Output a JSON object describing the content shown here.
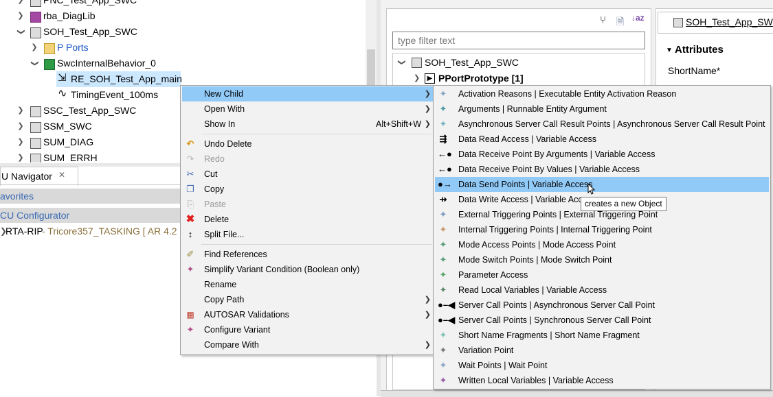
{
  "tree": {
    "rows": [
      {
        "label": "PNC_Test_App_SWC",
        "icon": "component-icon"
      },
      {
        "label": "rba_DiagLib",
        "icon": "library-icon"
      },
      {
        "label": "SOH_Test_App_SWC",
        "icon": "component-icon"
      },
      {
        "label": "P Ports",
        "icon": "folder-icon"
      },
      {
        "label": "SwcInternalBehavior_0",
        "icon": "behavior-icon"
      },
      {
        "label": "RE_SOH_Test_App_main",
        "icon": "runnable-icon"
      },
      {
        "label": "TimingEvent_100ms",
        "icon": "timing-event-icon"
      },
      {
        "label": "SSC_Test_App_SWC",
        "icon": "component-icon"
      },
      {
        "label": "SSM_SWC",
        "icon": "component-icon"
      },
      {
        "label": "SUM_DIAG",
        "icon": "component-icon"
      },
      {
        "label": "SUM_ERRH",
        "icon": "component-icon"
      }
    ]
  },
  "navigator": {
    "tab_label": "U Navigator",
    "favorites_label": "avorites",
    "ecu_config_label": "CU Configurator",
    "project_name": "RTA-RIP",
    "project_detail": " - Tricore357_TASKING [ AR 4.2"
  },
  "right_pane": {
    "filter_placeholder": "type filter text",
    "root_node": "SOH_Test_App_SWC",
    "child_node": "PPortPrototype [1]",
    "editor_title": "SOH_Test_App_SWC",
    "attributes_label": "Attributes",
    "shortname_label": "ShortName*"
  },
  "context_menu": {
    "groups": [
      [
        {
          "label": "New Child",
          "icon": "",
          "submenu": true,
          "highlighted": true
        },
        {
          "label": "Open With",
          "icon": "",
          "submenu": true
        },
        {
          "label": "Show In",
          "icon": "",
          "shortcut": "Alt+Shift+W",
          "submenu": true
        }
      ],
      [
        {
          "label": "Undo Delete",
          "icon": "undo-icon"
        },
        {
          "label": "Redo",
          "icon": "redo-icon",
          "disabled": true
        },
        {
          "label": "Cut",
          "icon": "cut-icon"
        },
        {
          "label": "Copy",
          "icon": "copy-icon"
        },
        {
          "label": "Paste",
          "icon": "paste-icon",
          "disabled": true
        },
        {
          "label": "Delete",
          "icon": "delete-icon"
        },
        {
          "label": "Split File...",
          "icon": "split-file-icon"
        }
      ],
      [
        {
          "label": "Find References",
          "icon": "find-references-icon"
        },
        {
          "label": "Simplify Variant Condition (Boolean only)",
          "icon": "variant-icon"
        },
        {
          "label": "Rename",
          "icon": ""
        },
        {
          "label": "Copy Path",
          "icon": "",
          "submenu": true
        },
        {
          "label": "AUTOSAR Validations",
          "icon": "validation-icon",
          "submenu": true
        },
        {
          "label": "Configure Variant",
          "icon": "variant-icon"
        },
        {
          "label": "Compare With",
          "icon": "",
          "submenu": true
        }
      ]
    ]
  },
  "submenu": {
    "items": [
      {
        "label": "Activation Reasons | Executable Entity Activation Reason",
        "icon": "element-icon"
      },
      {
        "label": "Arguments | Runnable Entity Argument",
        "icon": "element-icon"
      },
      {
        "label": "Asynchronous Server Call Result Points | Asynchronous Server Call Result Point",
        "icon": "element-icon"
      },
      {
        "label": "Data Read Access | Variable Access",
        "icon": "data-read-icon"
      },
      {
        "label": "Data Receive Point By Arguments | Variable Access",
        "icon": "data-receive-icon"
      },
      {
        "label": "Data Receive Point By Values | Variable Access",
        "icon": "data-receive-icon"
      },
      {
        "label": "Data Send Points | Variable Access",
        "icon": "data-send-icon",
        "highlighted": true
      },
      {
        "label": "Data Write Access | Variable Access",
        "icon": "data-write-icon"
      },
      {
        "label": "External Triggering Points | External Triggering Point",
        "icon": "element-icon"
      },
      {
        "label": "Internal Triggering Points | Internal Triggering Point",
        "icon": "element-icon"
      },
      {
        "label": "Mode Access Points | Mode Access Point",
        "icon": "element-icon"
      },
      {
        "label": "Mode Switch Points | Mode Switch Point",
        "icon": "element-icon"
      },
      {
        "label": "Parameter Access",
        "icon": "element-icon"
      },
      {
        "label": "Read Local Variables | Variable Access",
        "icon": "element-icon"
      },
      {
        "label": "Server Call Points | Asynchronous Server Call Point",
        "icon": "server-call-icon"
      },
      {
        "label": "Server Call Points | Synchronous Server Call Point",
        "icon": "server-call-icon"
      },
      {
        "label": "Short Name Fragments | Short Name Fragment",
        "icon": "element-icon"
      },
      {
        "label": "Variation Point",
        "icon": "element-icon"
      },
      {
        "label": "Wait Points | Wait Point",
        "icon": "element-icon"
      },
      {
        "label": "Written Local Variables | Variable Access",
        "icon": "element-icon"
      }
    ],
    "tooltip": "creates a new Object"
  },
  "colors": {
    "highlight": "#91c9f7",
    "selection": "#cce8ff",
    "link": "#3b6ab3"
  }
}
